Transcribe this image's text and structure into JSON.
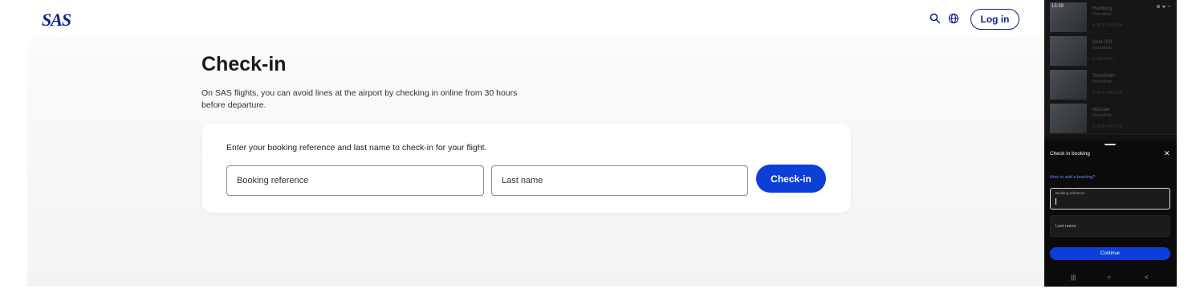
{
  "header": {
    "logo_text": "SAS",
    "search_icon": "search-icon",
    "globe_icon": "globe-icon",
    "login_label": "Log in"
  },
  "main": {
    "title": "Check-in",
    "description": "On SAS flights, you can avoid lines at the airport by checking in online from 30 hours before departure.",
    "card": {
      "instruction": "Enter your booking reference and last name to check-in for your flight.",
      "booking_placeholder": "Booking reference",
      "lastname_placeholder": "Last name",
      "submit_label": "Check-in"
    }
  },
  "phone": {
    "status": {
      "time": "15:39",
      "icons": "⊘ ᯤ ◔"
    },
    "destinations": [
      {
        "city": "Hamburg",
        "sub": "Roundtrip",
        "price": "fr. NOK 594 NOK"
      },
      {
        "city": "Oslo OSL",
        "sub": "Roundtrip",
        "price": "fr. 463 NOK"
      },
      {
        "city": "Stockholm",
        "sub": "Roundtrip",
        "price": "fr. NOK 443 NOK"
      },
      {
        "city": "Warsaw",
        "sub": "Roundtrip",
        "price": "fr. NOK 443 NOK"
      }
    ],
    "sheet": {
      "title": "Check in booking",
      "close_icon": "close-icon",
      "help_link": "How to add a booking?",
      "booking_label": "Booking reference",
      "lastname_label": "Last name",
      "continue_label": "Continue"
    },
    "nav": {
      "recent": "|||",
      "home": "○",
      "back": "<"
    }
  },
  "colors": {
    "brand": "#0b1f8f",
    "primary_button": "#0b3fd8",
    "link": "#5b8cff"
  }
}
